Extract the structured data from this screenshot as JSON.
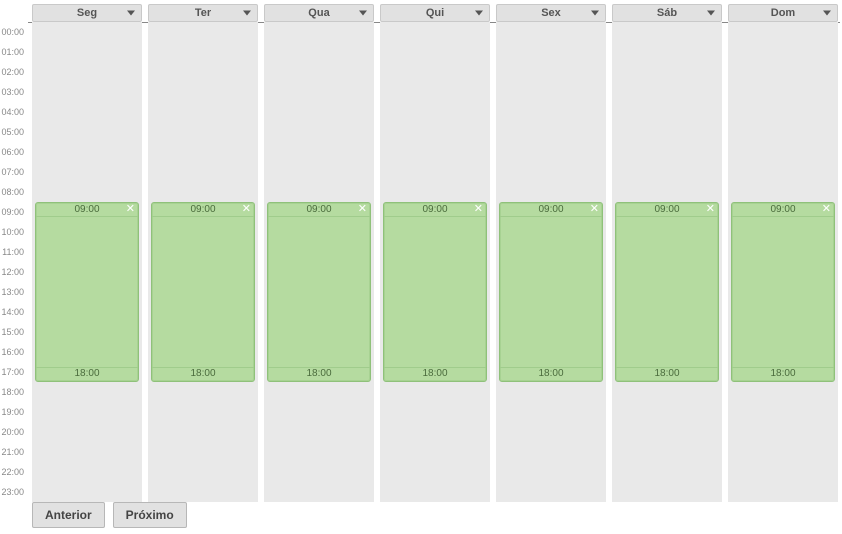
{
  "hours": [
    "00:00",
    "01:00",
    "02:00",
    "03:00",
    "04:00",
    "05:00",
    "06:00",
    "07:00",
    "08:00",
    "09:00",
    "10:00",
    "11:00",
    "12:00",
    "13:00",
    "14:00",
    "15:00",
    "16:00",
    "17:00",
    "18:00",
    "19:00",
    "20:00",
    "21:00",
    "22:00",
    "23:00"
  ],
  "days": [
    {
      "label": "Seg",
      "event": {
        "start": "09:00",
        "end": "18:00",
        "startHour": 9,
        "endHour": 18
      }
    },
    {
      "label": "Ter",
      "event": {
        "start": "09:00",
        "end": "18:00",
        "startHour": 9,
        "endHour": 18
      }
    },
    {
      "label": "Qua",
      "event": {
        "start": "09:00",
        "end": "18:00",
        "startHour": 9,
        "endHour": 18
      }
    },
    {
      "label": "Qui",
      "event": {
        "start": "09:00",
        "end": "18:00",
        "startHour": 9,
        "endHour": 18
      }
    },
    {
      "label": "Sex",
      "event": {
        "start": "09:00",
        "end": "18:00",
        "startHour": 9,
        "endHour": 18
      }
    },
    {
      "label": "Sáb",
      "event": {
        "start": "09:00",
        "end": "18:00",
        "startHour": 9,
        "endHour": 18
      }
    },
    {
      "label": "Dom",
      "event": {
        "start": "09:00",
        "end": "18:00",
        "startHour": 9,
        "endHour": 18
      }
    }
  ],
  "buttons": {
    "prev": "Anterior",
    "next": "Próximo"
  },
  "hourHeightPx": 20
}
